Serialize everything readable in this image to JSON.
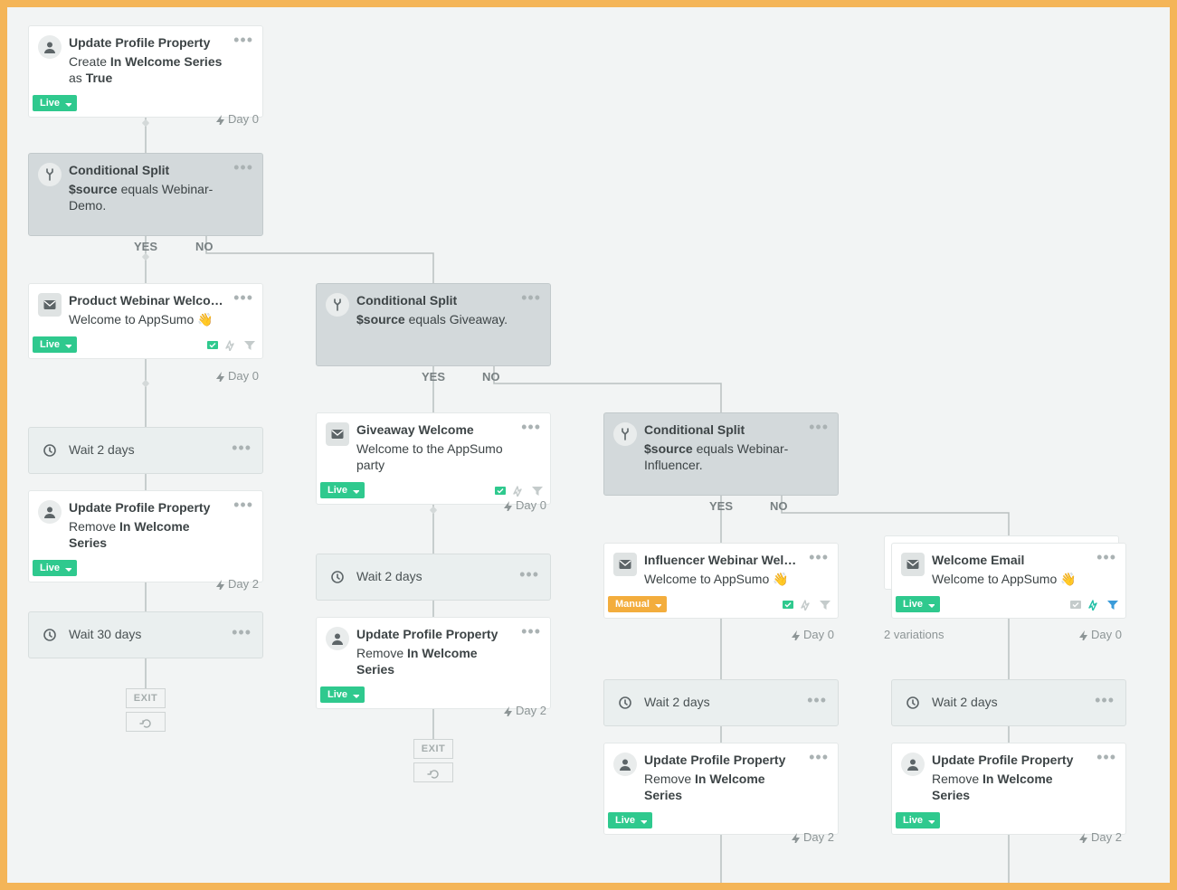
{
  "labels": {
    "yes": "YES",
    "no": "NO",
    "exit": "EXIT"
  },
  "nodes": {
    "n1": {
      "title": "Update Profile Property",
      "desc_prefix": "Create ",
      "desc_bold": "In Welcome Series",
      "desc_suffix": " as ",
      "desc_bold2": "True",
      "status": "Live",
      "timing": "Day 0"
    },
    "n2": {
      "title": "Conditional Split",
      "desc_prefix": "",
      "desc_bold": "$source",
      "desc_suffix": " equals Webinar-Demo."
    },
    "n3": {
      "title": "Product Webinar Welcome",
      "subject": "Welcome to AppSumo 👋",
      "status": "Live",
      "timing": "Day 0"
    },
    "n4": {
      "title": "Wait 2 days"
    },
    "n5": {
      "title": "Update Profile Property",
      "desc_prefix": "Remove ",
      "desc_bold": "In Welcome Series",
      "status": "Live",
      "timing": "Day 2"
    },
    "n6": {
      "title": "Wait 30 days"
    },
    "n7": {
      "title": "Conditional Split",
      "desc_prefix": "",
      "desc_bold": "$source",
      "desc_suffix": " equals Giveaway."
    },
    "n8": {
      "title": "Giveaway Welcome",
      "subject": "Welcome to the AppSumo party",
      "status": "Live",
      "timing": "Day 0"
    },
    "n9": {
      "title": "Wait 2 days"
    },
    "n10": {
      "title": "Update Profile Property",
      "desc_prefix": "Remove ",
      "desc_bold": "In Welcome Series",
      "status": "Live",
      "timing": "Day 2"
    },
    "n11": {
      "title": "Conditional Split",
      "desc_prefix": "",
      "desc_bold": "$source",
      "desc_suffix": " equals Webinar-Influencer."
    },
    "n12": {
      "title": "Influencer Webinar Welco…",
      "subject": "Welcome to AppSumo 👋",
      "status": "Manual",
      "timing": "Day 0"
    },
    "n13": {
      "title": "Wait 2 days"
    },
    "n14": {
      "title": "Update Profile Property",
      "desc_prefix": "Remove ",
      "desc_bold": "In Welcome Series",
      "status": "Live",
      "timing": "Day 2"
    },
    "n15": {
      "title": "Welcome Email",
      "subject": "Welcome to AppSumo 👋",
      "status": "Live",
      "variations": "2 variations",
      "timing": "Day 0"
    },
    "n16": {
      "title": "Wait 2 days"
    },
    "n17": {
      "title": "Update Profile Property",
      "desc_prefix": "Remove ",
      "desc_bold": "In Welcome Series",
      "status": "Live",
      "timing": "Day 2"
    }
  }
}
